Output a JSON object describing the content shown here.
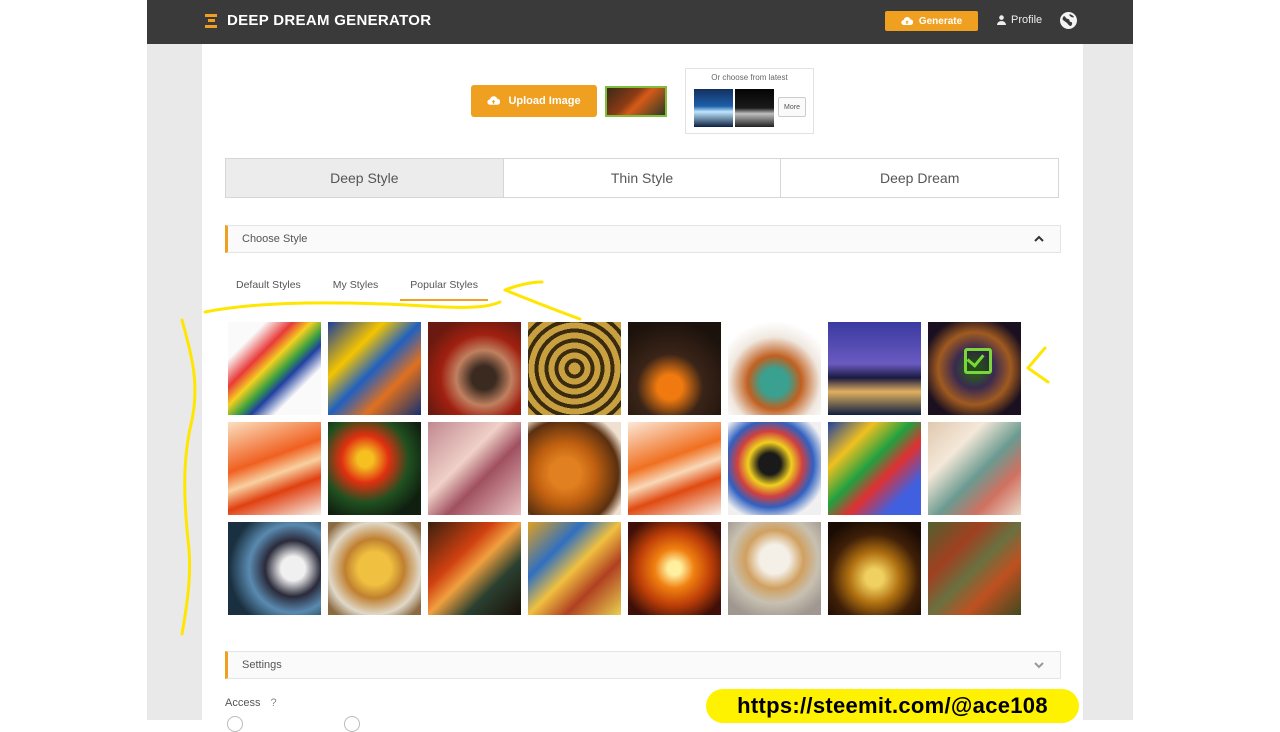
{
  "header": {
    "brand": "DEEP DREAM GENERATOR",
    "generate_label": "Generate",
    "profile_label": "Profile"
  },
  "upload": {
    "button_label": "Upload Image",
    "latest_label": "Or choose from latest",
    "more_label": "More"
  },
  "modes": [
    {
      "label": "Deep Style",
      "active": true
    },
    {
      "label": "Thin Style",
      "active": false
    },
    {
      "label": "Deep Dream",
      "active": false
    }
  ],
  "choose_style": {
    "title": "Choose Style",
    "tabs": [
      {
        "label": "Default Styles"
      },
      {
        "label": "My Styles"
      },
      {
        "label": "Popular Styles",
        "active": true
      }
    ]
  },
  "styles": [
    {
      "bg": "linear-gradient(135deg,#fafafa 20%,#e83a3a 35%,#f5d020 45%,#3aa040 55%,#2040a0 62%,#fafafa 75%)"
    },
    {
      "bg": "linear-gradient(135deg,#1c3f9a,#f5c400 30%,#2060c0 50%,#e07020 70%,#143070)"
    },
    {
      "bg": "radial-gradient(circle at 60% 60%,#3a2a20 15%,#c08060 35%,#a02010 55%,#6a1a10 80%)"
    },
    {
      "bg": "repeating-radial-gradient(circle at 50% 50%,#c9a040 0 6px,#3a2a10 6px 10px)"
    },
    {
      "bg": "radial-gradient(circle at 45% 70%,#f07a10 15%,#3a2418 40%,#1c120c 80%)"
    },
    {
      "bg": "radial-gradient(circle at 50% 65%,#3aa090 18%,#c06020 35%,#f0e8e0 60%,#ffffff 80%)"
    },
    {
      "bg": "linear-gradient(180deg,#3a3aa0,#6a5ac0 45%,#1a1a40 60%,#e0b060 75%,#102040)"
    },
    {
      "bg": "radial-gradient(circle at 50% 50%,#2a5a20 10%,#3a2a50 30%,#a05a20 55%,#1a1020 80%)",
      "selected": true
    },
    {
      "bg": "linear-gradient(160deg,#fbe0c0,#f06020 40%,#f8d0a0 55%,#e04010 70%,#f7f0e8)"
    },
    {
      "bg": "radial-gradient(circle at 40% 40%,#f5c020 10%,#e03010 30%,#205020 55%,#102010 80%)"
    },
    {
      "bg": "linear-gradient(135deg,#c08890,#f0d0c8 40%,#a05060 60%,#e8c0c0)"
    },
    {
      "bg": "radial-gradient(circle at 40% 55%,#e08020 20%,#c06010 40%,#5a3010 70%,#f0e0d0 85%)"
    },
    {
      "bg": "linear-gradient(160deg,#fbe8d8,#f07020 40%,#f8d8b8 55%,#e04a10 70%,#f7f0e8)"
    },
    {
      "bg": "radial-gradient(circle at 45% 45%,#1a1a1a 15%,#f0d020 30%,#d04040 45%,#3060c0 60%,#f0f0f0 80%)"
    },
    {
      "bg": "linear-gradient(135deg,#2040a0,#f0c020 25%,#20a040 45%,#e03030 60%,#4060e0 80%)"
    },
    {
      "bg": "linear-gradient(135deg,#e0c8b0,#f4e8d8 30%,#6a9a90 55%,#d07060 75%,#e8d8c8)"
    },
    {
      "bg": "radial-gradient(circle at 70% 50%,#f0f0f0 15%,#2a2a3a 35%,#5a8ab0 55%,#1a3040 80%)"
    },
    {
      "bg": "radial-gradient(circle at 50% 50%,#f0c040 25%,#c08030 45%,#e0d8c8 70%,#8a6a40 90%)"
    },
    {
      "bg": "linear-gradient(135deg,#3a2010,#d04010 35%,#f0a040 50%,#2a4030 70%,#1a1008)"
    },
    {
      "bg": "linear-gradient(135deg,#e0a020,#3070c0 30%,#f0c040 50%,#b04020 70%,#e8d050)"
    },
    {
      "bg": "radial-gradient(circle at 50% 50%,#fff0a0 10%,#f08010 30%,#c04008 55%,#401008 85%)"
    },
    {
      "bg": "radial-gradient(circle at 50% 40%,#f4f0e8 20%,#d0a060 40%,#c8c0b0 60%,#a09890 85%)"
    },
    {
      "bg": "radial-gradient(circle at 50% 60%,#f0d060 12%,#b07010 35%,#402008 60%,#1a0c04 85%)"
    },
    {
      "bg": "linear-gradient(135deg,#506030,#a04020 30%,#6a7040 50%,#c05020 70%,#404a20)"
    }
  ],
  "settings": {
    "title": "Settings",
    "access_label": "Access",
    "help_symbol": "?"
  },
  "watermark": "https://steemit.com/@ace108",
  "colors": {
    "accent": "#f0a020",
    "header_bg": "#3a3a3a",
    "annotation": "#fff200"
  }
}
